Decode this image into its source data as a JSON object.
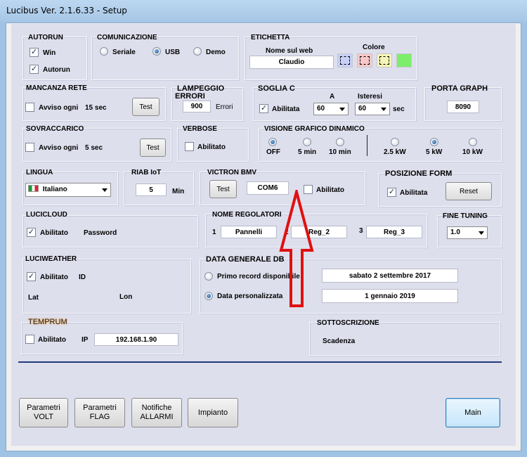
{
  "window": {
    "title": "Lucibus Ver. 2.1.6.33 - Setup"
  },
  "autorun": {
    "title": "AUTORUN",
    "win": {
      "label": "Win",
      "checked": true
    },
    "autorun": {
      "label": "Autorun",
      "checked": true
    }
  },
  "comunicazione": {
    "title": "COMUNICAZIONE",
    "options": [
      "Seriale",
      "USB",
      "Demo"
    ],
    "selected": "USB"
  },
  "etichetta": {
    "title": "ETICHETTA",
    "nome_label": "Nome sul web",
    "nome_value": "Claudio",
    "colore_label": "Colore",
    "colors": [
      "#c8d0f6",
      "#f6c8c8",
      "#f4f4b8",
      "#7dee6a"
    ]
  },
  "mancanza_rete": {
    "title": "MANCANZA RETE",
    "avviso_label": "Avviso ogni",
    "avviso_value": "15 sec",
    "checked": false,
    "test_label": "Test"
  },
  "lampeggio": {
    "title_line1": "LAMPEGGIO",
    "title_line2": "ERRORI",
    "value": "900",
    "unit": "Errori"
  },
  "soglia_c": {
    "title": "SOGLIA C",
    "abilitata_label": "Abilitata",
    "checked": true,
    "a_label": "A",
    "a_value": "60",
    "isteresi_label": "Isteresi",
    "isteresi_value": "60",
    "unit": "sec"
  },
  "porta_graph": {
    "title": "PORTA GRAPH",
    "value": "8090"
  },
  "sovraccarico": {
    "title": "SOVRACCARICO",
    "avviso_label": "Avviso ogni",
    "avviso_value": "5 sec",
    "checked": false,
    "test_label": "Test"
  },
  "verbose": {
    "title": "VERBOSE",
    "abilitato_label": "Abilitato",
    "checked": false
  },
  "visione": {
    "title": "VISIONE GRAFICO DINAMICO",
    "options_left": [
      "OFF",
      "5 min",
      "10 min"
    ],
    "options_right": [
      "2.5 kW",
      "5 kW",
      "10 kW"
    ],
    "selected_left": "OFF",
    "selected_right": "5 kW"
  },
  "lingua": {
    "title": "LINGUA",
    "value": "Italiano"
  },
  "riab_iot": {
    "title": "RIAB IoT",
    "value": "5",
    "unit": "Min"
  },
  "victron": {
    "title": "VICTRON BMV",
    "test_label": "Test",
    "port_value": "COM6",
    "abilitato_label": "Abilitato",
    "checked": false
  },
  "posizione_form": {
    "title": "POSIZIONE FORM",
    "abilitata_label": "Abilitata",
    "checked": true,
    "reset_label": "Reset"
  },
  "lucicloud": {
    "title": "LUCICLOUD",
    "abilitato_label": "Abilitato",
    "checked": true,
    "password_label": "Password"
  },
  "nome_regolatori": {
    "title": "NOME REGOLATORI",
    "items": [
      {
        "num": "1",
        "value": "Pannelli"
      },
      {
        "num": "2",
        "value": "Reg_2"
      },
      {
        "num": "3",
        "value": "Reg_3"
      }
    ]
  },
  "fine_tuning": {
    "title": "FINE TUNING",
    "value": "1.0"
  },
  "luciweather": {
    "title": "LUCIWEATHER",
    "abilitato_label": "Abilitato",
    "checked": true,
    "id_label": "ID",
    "lat_label": "Lat",
    "lon_label": "Lon"
  },
  "data_db": {
    "title": "DATA GENERALE DB",
    "option1_label": "Primo record disponibile",
    "option1_value": "sabato 2 settembre 2017",
    "option2_label": "Data personalizzata",
    "option2_value": "1 gennaio 2019",
    "selected": "Data personalizzata"
  },
  "temprum": {
    "title": "TEMPRUM",
    "abilitato_label": "Abilitato",
    "checked": false,
    "ip_label": "IP",
    "ip_value": "192.168.1.90"
  },
  "sottoscrizione": {
    "title": "SOTTOSCRIZIONE",
    "scadenza_label": "Scadenza"
  },
  "buttons": {
    "parametri_volt": [
      "Parametri",
      "VOLT"
    ],
    "parametri_flag": [
      "Parametri",
      "FLAG"
    ],
    "notifiche_allarmi": [
      "Notifiche",
      "ALLARMI"
    ],
    "impianto": "Impianto",
    "main": "Main"
  }
}
